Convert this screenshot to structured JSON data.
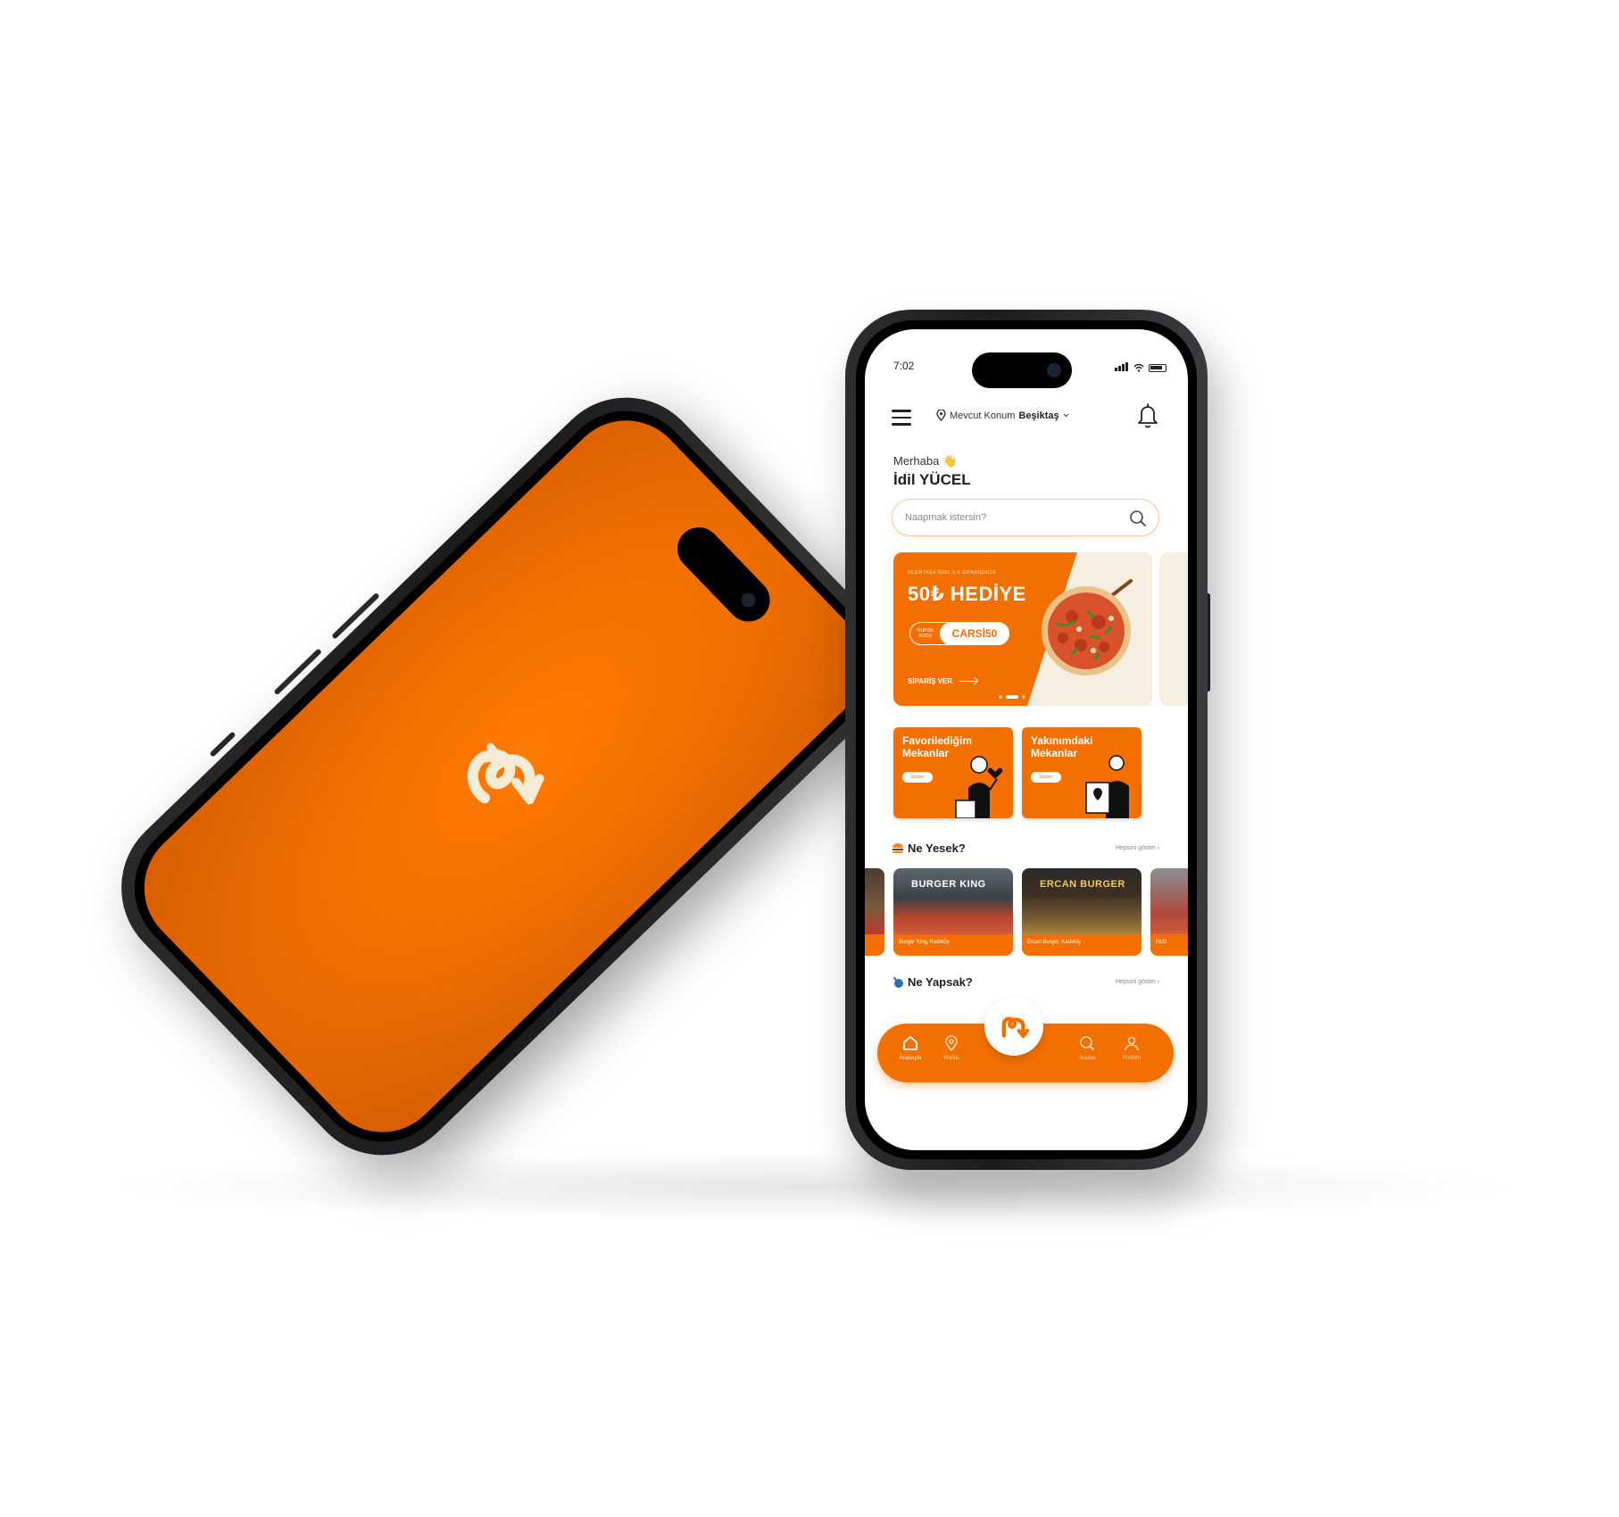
{
  "theme": {
    "accent": "#f26f00",
    "cream": "#f7eee2",
    "logo_color": "#f6ecd6",
    "dark": "#1f1f1f"
  },
  "status_bar": {
    "time": "7:02"
  },
  "header": {
    "location_label": "Mevcut Konum",
    "location_value": "Beşiktaş",
    "menu_icon": "hamburger-icon",
    "notification_icon": "bell-icon"
  },
  "greeting": {
    "hello": "Merhaba",
    "hello_emoji": "👋",
    "name": "İdil YÜCEL"
  },
  "search": {
    "placeholder": "Naapmak istersin?",
    "value": "",
    "icon": "search-icon"
  },
  "promo_banner": {
    "kicker": "BEŞİKTAŞA ÖZEL İLK SİPARİŞİNİZE",
    "title": "50₺ HEDİYE",
    "coupon_label": "KUPON KODU",
    "coupon_code": "CARSİ50",
    "cta": "SİPARİŞ VER",
    "slide_count": 3,
    "active_slide": 1
  },
  "quick_cards": [
    {
      "title": "Favorilediğim Mekanlar",
      "button": "Göster"
    },
    {
      "title": "Yakınımdaki Mekanlar",
      "button": "Göster"
    }
  ],
  "sections": {
    "eat": {
      "title": "Ne Yesek?",
      "link": "Hepsini göster ›",
      "icon": "burger-icon"
    },
    "do": {
      "title": "Ne Yapsak?",
      "link": "Hepsini göster ›",
      "icon": "activity-icon"
    }
  },
  "restaurants": [
    {
      "name": "Burger King, Kadıköy",
      "sign": "BURGER KING"
    },
    {
      "name": "Ercan Burger, Kadıköy",
      "sign": "ERCAN BURGER"
    },
    {
      "name": "McD",
      "sign": ""
    }
  ],
  "tabbar": {
    "tabs": [
      {
        "label": "Anasayfa",
        "icon": "home-icon",
        "active": true
      },
      {
        "label": "Harita",
        "icon": "map-pin-icon",
        "active": false
      },
      {
        "label": "Arama",
        "icon": "search-icon",
        "active": false
      },
      {
        "label": "Profilim",
        "icon": "user-icon",
        "active": false
      }
    ],
    "center_icon": "app-logo-icon"
  }
}
